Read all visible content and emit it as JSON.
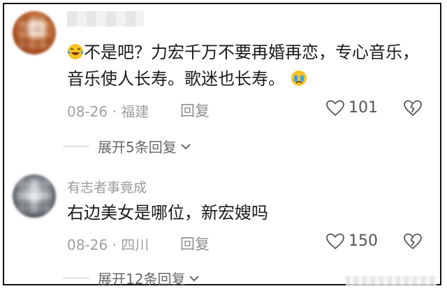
{
  "comments": [
    {
      "username": "",
      "text_before_emoji": "不是吧？力宏千万不要再婚再恋，专心音乐，音乐使人长寿。歌迷也长寿。",
      "leading_emoji": "laughing-crying-emoji-icon",
      "trailing_emoji": "crying-emoji-icon",
      "date": "08-26",
      "location": "福建",
      "reply_label": "回复",
      "likes": "101",
      "expand_label": "展开5条回复"
    },
    {
      "username": "有志者事竟成",
      "text": "右边美女是哪位，新宏嫂吗",
      "date": "08-26",
      "location": "四川",
      "reply_label": "回复",
      "likes": "150",
      "expand_label": "展开12条回复"
    }
  ],
  "meta_separator": " · ",
  "colors": {
    "text": "#1a1a1a",
    "meta": "#a0a0a0",
    "emoji_yellow": "#f7c325",
    "tear_blue": "#3aa2f0"
  }
}
